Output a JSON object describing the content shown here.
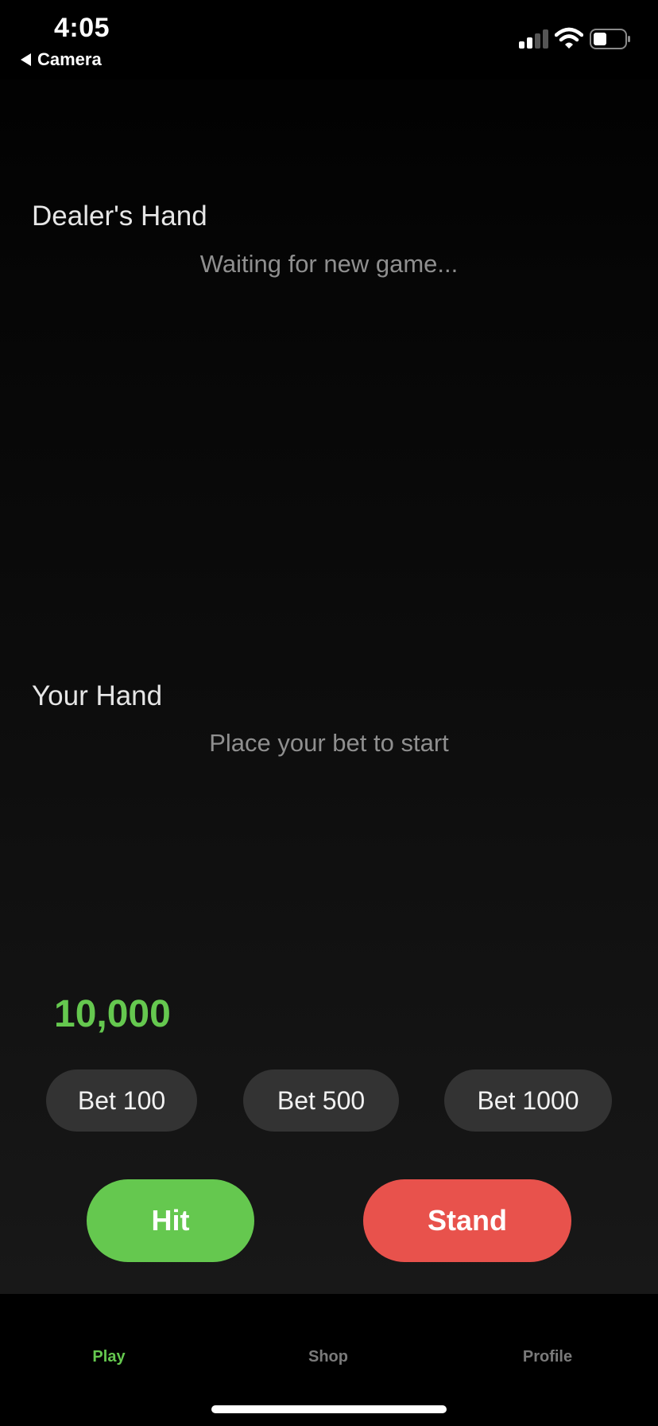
{
  "status_bar": {
    "time": "4:05",
    "back_label": "Camera",
    "icons": [
      "back-arrow-icon",
      "cellular-signal-icon",
      "wifi-icon",
      "battery-icon"
    ]
  },
  "dealer": {
    "title": "Dealer's Hand",
    "message": "Waiting for new game..."
  },
  "player": {
    "title": "Your Hand",
    "message": "Place your bet to start"
  },
  "balance": "10,000",
  "bets": [
    {
      "label": "Bet 100"
    },
    {
      "label": "Bet 500"
    },
    {
      "label": "Bet 1000"
    }
  ],
  "actions": {
    "hit": "Hit",
    "stand": "Stand"
  },
  "tabs": [
    {
      "label": "Play",
      "active": true
    },
    {
      "label": "Shop",
      "active": false
    },
    {
      "label": "Profile",
      "active": false
    }
  ],
  "colors": {
    "accent_green": "#65c84f",
    "stand_red": "#e8524c",
    "bet_button_bg": "#333333",
    "inactive_tab": "#7a7a7a"
  }
}
